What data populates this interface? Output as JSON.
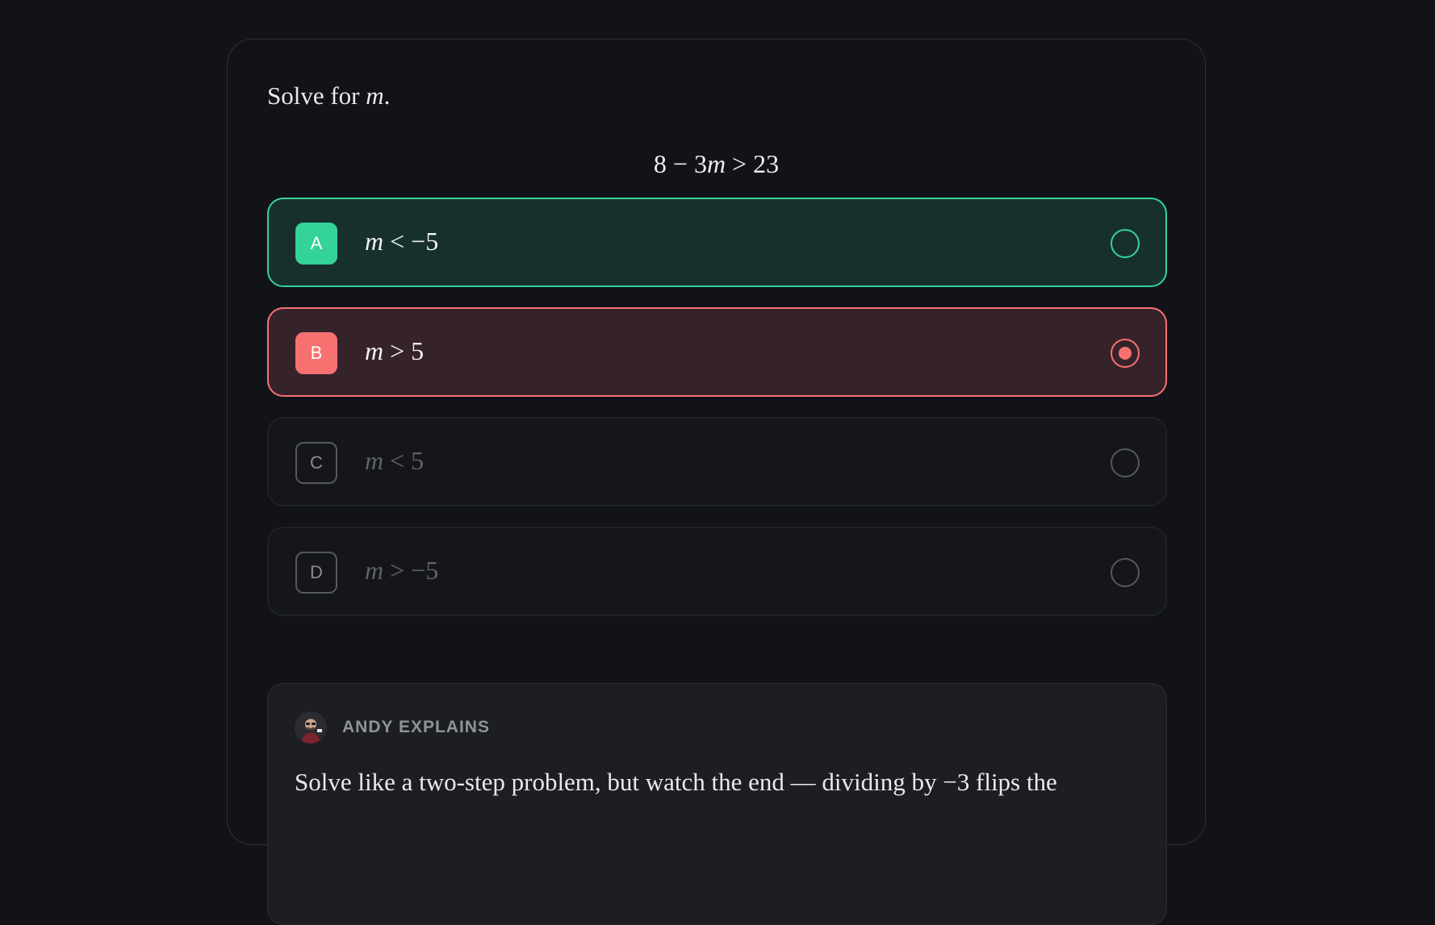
{
  "question": {
    "prompt_prefix": "Solve for",
    "prompt_variable": "m",
    "prompt_suffix": ".",
    "equation": {
      "lhs": "8 − 3",
      "variable": "m",
      "rhs": " > 23"
    }
  },
  "options": [
    {
      "letter": "A",
      "variable": "m",
      "expression": " < −5",
      "state": "correct"
    },
    {
      "letter": "B",
      "variable": "m",
      "expression": " > 5",
      "state": "selected-wrong"
    },
    {
      "letter": "C",
      "variable": "m",
      "expression": " < 5",
      "state": "muted"
    },
    {
      "letter": "D",
      "variable": "m",
      "expression": " > −5",
      "state": "muted"
    }
  ],
  "explanation": {
    "label": "ANDY EXPLAINS",
    "text": "Solve like a two-step problem, but watch the end — dividing by −3 flips the"
  },
  "colors": {
    "correct": "#34d399",
    "wrong": "#f87171",
    "background": "#111318"
  },
  "icons": {
    "avatar": "andy-avatar-icon",
    "radio_empty": "radio-empty-icon",
    "radio_selected": "radio-selected-icon"
  }
}
